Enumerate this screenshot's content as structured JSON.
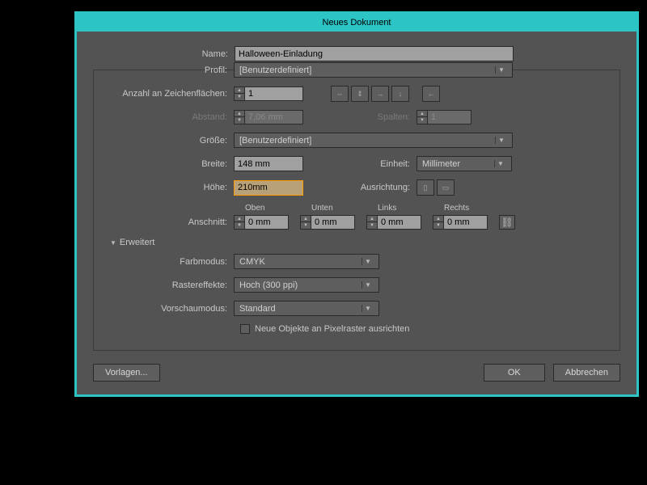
{
  "title": "Neues Dokument",
  "labels": {
    "name": "Name:",
    "profile": "Profil:",
    "artboards": "Anzahl an Zeichenflächen:",
    "spacing": "Abstand:",
    "columns": "Spalten:",
    "size": "Größe:",
    "width": "Breite:",
    "height": "Höhe:",
    "unit": "Einheit:",
    "orientation": "Ausrichtung:",
    "oben": "Oben",
    "unten": "Unten",
    "links": "Links",
    "rechts": "Rechts",
    "bleed": "Anschnitt:",
    "advanced": "Erweitert",
    "colormode": "Farbmodus:",
    "raster": "Rastereffekte:",
    "preview": "Vorschaumodus:",
    "align": "Neue Objekte an Pixelraster ausrichten"
  },
  "values": {
    "name": "Halloween-Einladung",
    "profile": "[Benutzerdefiniert]",
    "artboards": "1",
    "spacing": "7,06 mm",
    "columns": "1",
    "size": "[Benutzerdefiniert]",
    "width": "148 mm",
    "height": "210mm",
    "unit": "Millimeter",
    "bleed_top": "0 mm",
    "bleed_bottom": "0 mm",
    "bleed_left": "0 mm",
    "bleed_right": "0 mm",
    "colormode": "CMYK",
    "raster": "Hoch (300 ppi)",
    "preview": "Standard"
  },
  "buttons": {
    "templates": "Vorlagen...",
    "ok": "OK",
    "cancel": "Abbrechen"
  }
}
